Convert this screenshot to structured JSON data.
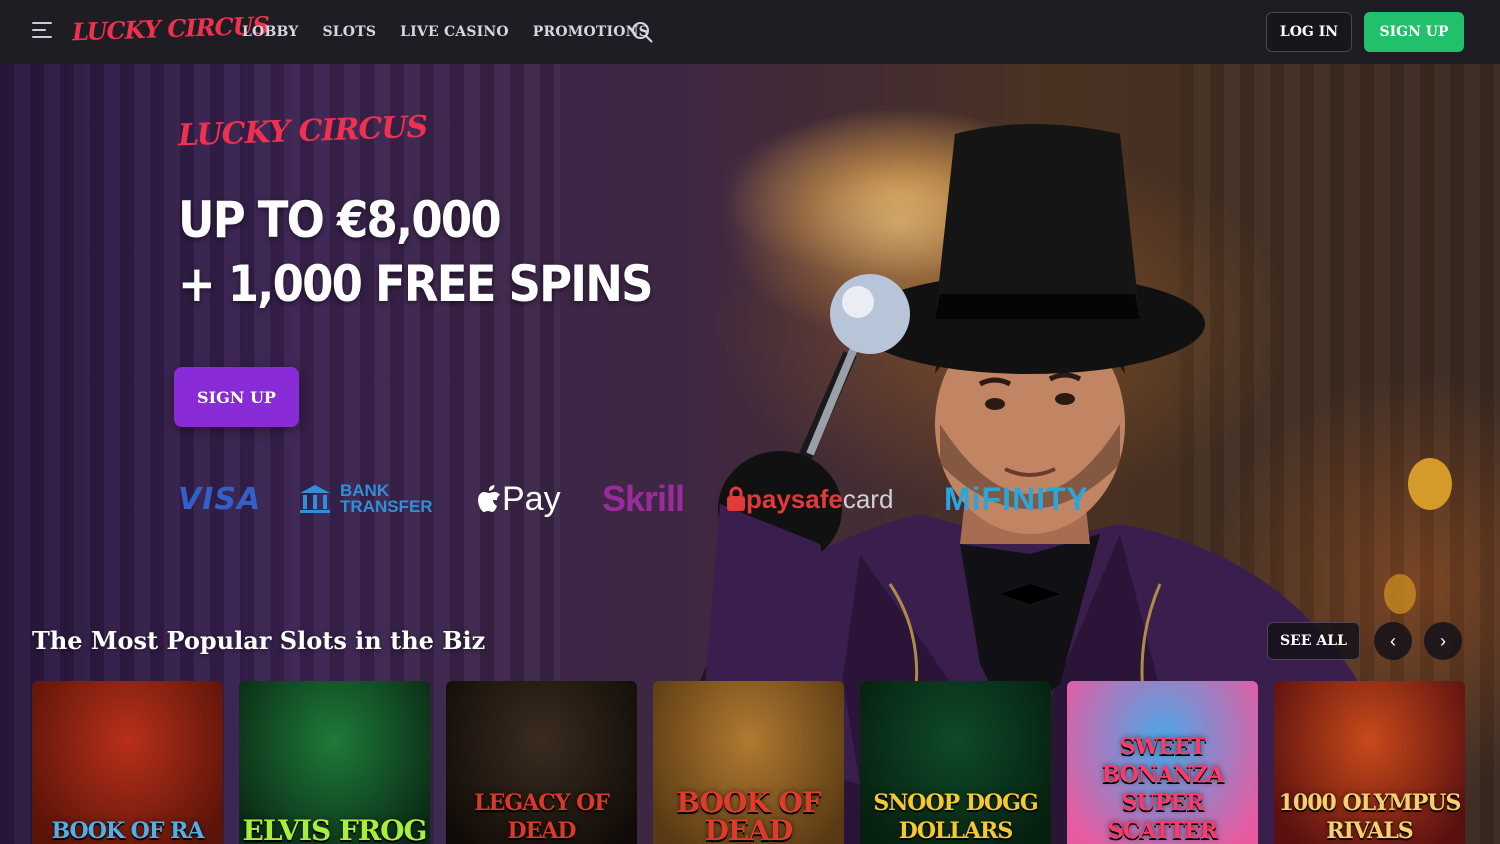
{
  "header": {
    "logo": "LUCKY CIRCUS",
    "nav": [
      "LOBBY",
      "SLOTS",
      "LIVE CASINO",
      "PROMOTIONS"
    ],
    "login_label": "LOG IN",
    "signup_label": "SIGN UP"
  },
  "hero": {
    "logo": "LUCKY CIRCUS",
    "headline_line1": "UP TO €8,000",
    "headline_line2": "+ 1,000 FREE SPINS",
    "signup_label": "SIGN UP",
    "payments": {
      "visa": "VISA",
      "bank_line1": "BANK",
      "bank_line2": "TRANSFER",
      "apple_pay": "Pay",
      "skrill": "Skrill",
      "paysafe_a": "paysafe",
      "paysafe_b": "card",
      "mifinity": "MiFINITY"
    }
  },
  "popular": {
    "title": "The Most Popular Slots in the Biz",
    "see_all_label": "SEE ALL",
    "prev_icon": "‹",
    "next_icon": "›",
    "games": [
      {
        "name": "BOOK OF RA",
        "bg1": "#b8301a",
        "bg2": "#5a1408",
        "color": "#4fb0e8"
      },
      {
        "name": "ELVIS FROG",
        "bg1": "#1e7a3a",
        "bg2": "#0a2a14",
        "color": "#a8ef3a"
      },
      {
        "name": "LEGACY OF DEAD",
        "bg1": "#3a2c20",
        "bg2": "#120c08",
        "color": "#d63a2a"
      },
      {
        "name": "BOOK OF DEAD",
        "bg1": "#b07a30",
        "bg2": "#5a3a14",
        "color": "#e03a2a"
      },
      {
        "name": "SNOOP DOGG DOLLARS",
        "bg1": "#0e4a2a",
        "bg2": "#06200e",
        "color": "#f5c830"
      },
      {
        "name": "SWEET BONANZA SUPER SCATTER",
        "bg1": "#4aa8e8",
        "bg2": "#e85aa0",
        "color": "#ff3a6a"
      },
      {
        "name": "1000 OLYMPUS RIVALS",
        "bg1": "#c84a1a",
        "bg2": "#5a1010",
        "color": "#f5d070"
      }
    ]
  }
}
